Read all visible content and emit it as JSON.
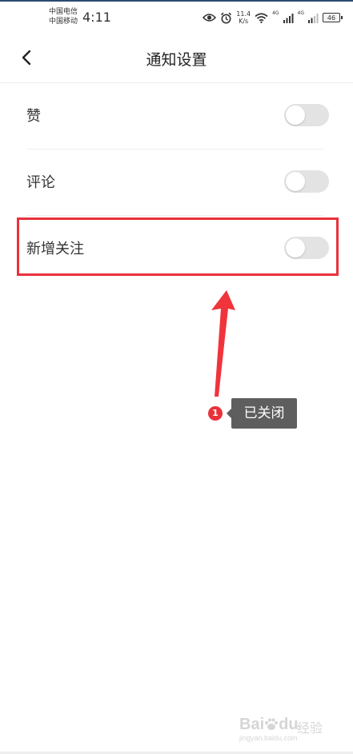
{
  "status_bar": {
    "carrier_1": "中国电信",
    "carrier_2": "中国移动",
    "time": "4:11",
    "net_speed_value": "11.4",
    "net_speed_unit": "K/s",
    "net_tag_1": "4G",
    "net_tag_2": "4G",
    "battery_level": "46",
    "icons": [
      "eye-icon",
      "alarm-icon",
      "wifi-icon",
      "signal-icon",
      "signal-icon",
      "battery-icon"
    ]
  },
  "header": {
    "title": "通知设置",
    "back_icon": "chevron-left-icon"
  },
  "settings": {
    "items": [
      {
        "label": "赞",
        "enabled": false
      },
      {
        "label": "评论",
        "enabled": false
      },
      {
        "label": "新增关注",
        "enabled": false
      }
    ]
  },
  "annotation": {
    "step_number": "1",
    "tooltip_text": "已关闭",
    "highlight_color": "#e8323a",
    "arrow_color": "#f0343c"
  },
  "watermark": {
    "logo_text_1": "Bai",
    "logo_text_2": "du",
    "cn_text": "经验",
    "url": "jingyan.baidu.com"
  }
}
